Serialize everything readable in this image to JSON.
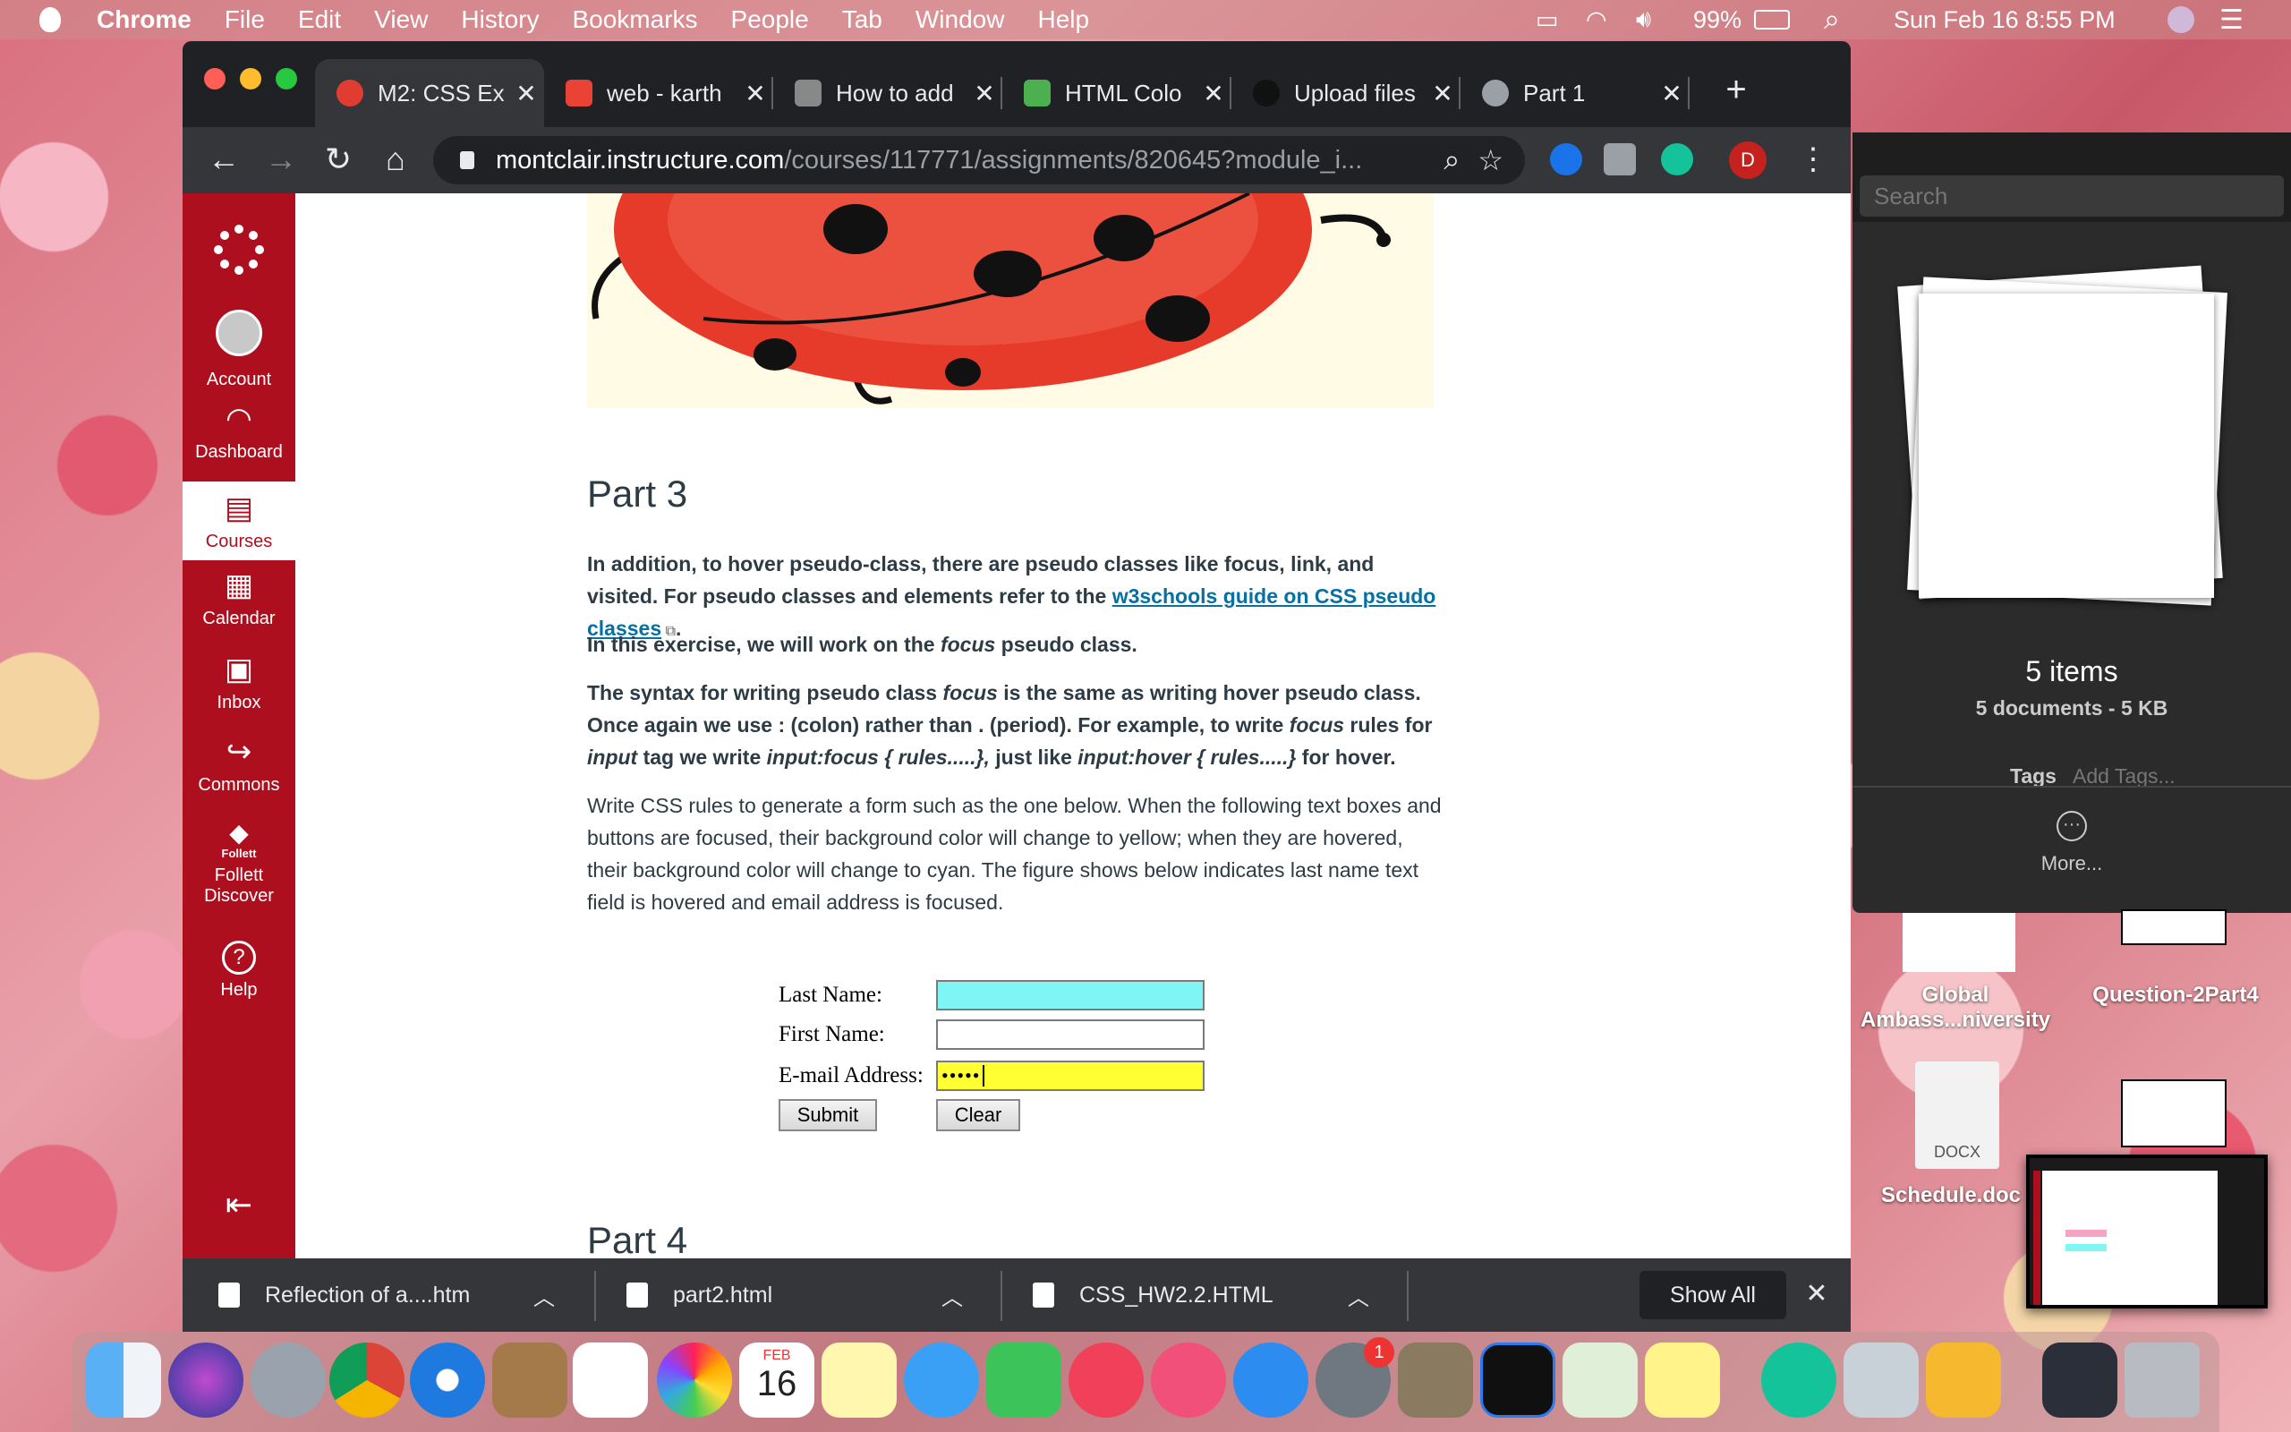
{
  "menubar": {
    "app": "Chrome",
    "items": [
      "File",
      "Edit",
      "View",
      "History",
      "Bookmarks",
      "People",
      "Tab",
      "Window",
      "Help"
    ],
    "battery": "99%",
    "datetime": "Sun Feb 16  8:55 PM"
  },
  "browser": {
    "tabs": [
      {
        "title": "M2: CSS Ex",
        "color": "#e03c31",
        "active": true
      },
      {
        "title": "web - karth",
        "color": "#ea4335",
        "active": false
      },
      {
        "title": "How to add",
        "color": "#888888",
        "active": false
      },
      {
        "title": "HTML Colo",
        "color": "#4caf50",
        "active": false
      },
      {
        "title": "Upload files",
        "color": "#333333",
        "active": false
      },
      {
        "title": "Part 1",
        "color": "#9aa0a6",
        "active": false
      }
    ],
    "url_host": "montclair.instructure.com",
    "url_path": "/courses/117771/assignments/820645?module_i...",
    "profile_initial": "D"
  },
  "sidenav": {
    "items": [
      {
        "label": "Account",
        "icon": "account-icon"
      },
      {
        "label": "Dashboard",
        "icon": "dashboard-icon"
      },
      {
        "label": "Courses",
        "icon": "courses-icon"
      },
      {
        "label": "Calendar",
        "icon": "calendar-icon"
      },
      {
        "label": "Inbox",
        "icon": "inbox-icon"
      },
      {
        "label": "Commons",
        "icon": "commons-icon"
      },
      {
        "label": "Follett Discover",
        "icon": "follett-icon",
        "logo_text": "Follett"
      },
      {
        "label": "Help",
        "icon": "help-icon"
      }
    ],
    "active": "Courses"
  },
  "content": {
    "part3_heading": "Part 3",
    "p1_a": "In addition, to hover pseudo-class, there are pseudo classes like focus, link, and visited. For pseudo classes and elements refer to the ",
    "p1_link": "w3schools guide on CSS pseudo classes",
    "p1_b": ".",
    "p2_a": "In this exercise, we will work on the ",
    "p2_em": "focus",
    "p2_b": " pseudo class.",
    "p3_a": "The syntax for writing pseudo class ",
    "p3_em1": "focus",
    "p3_b": " is the same as writing hover pseudo class. Once again we use : (colon) rather than . (period). For example, to write ",
    "p3_em2": "focus",
    "p3_c": " rules for ",
    "p3_em3": "input",
    "p3_d": " tag we write ",
    "p3_em4": "input:focus { rules.....},",
    "p3_e": " just like ",
    "p3_em5": "input:hover { rules.....}",
    "p3_f": " for hover.",
    "p4": "Write CSS rules to generate a form such as the one below. When the following text boxes and buttons are focused, their background color will change to yellow; when they are hovered, their background color will change to cyan. The figure shows below indicates last name text field is hovered and email address is focused.",
    "form": {
      "last_name_label": "Last Name:",
      "first_name_label": "First Name:",
      "email_label": "E-mail Address:",
      "email_value": "•••••",
      "submit": "Submit",
      "clear": "Clear",
      "hover_color": "#7ff5f5",
      "focus_color": "#ffff33"
    },
    "part4_heading": "Part 4"
  },
  "downloads": {
    "items": [
      "Reflection of a....htm",
      "part2.html",
      "CSS_HW2.2.HTML"
    ],
    "show_all": "Show All"
  },
  "stack_panel": {
    "search_placeholder": "Search",
    "count": "5 items",
    "summary": "5 documents - 5 KB",
    "tags_label": "Tags",
    "tags_add": "Add Tags...",
    "more": "More..."
  },
  "desktop": {
    "items": [
      "Global Ambass...niversity",
      "Question-2Part4",
      "Schedule.doc"
    ],
    "docx_label": "DOCX"
  },
  "dock": {
    "calendar_month": "FEB",
    "calendar_day": "16",
    "badge": "1"
  }
}
